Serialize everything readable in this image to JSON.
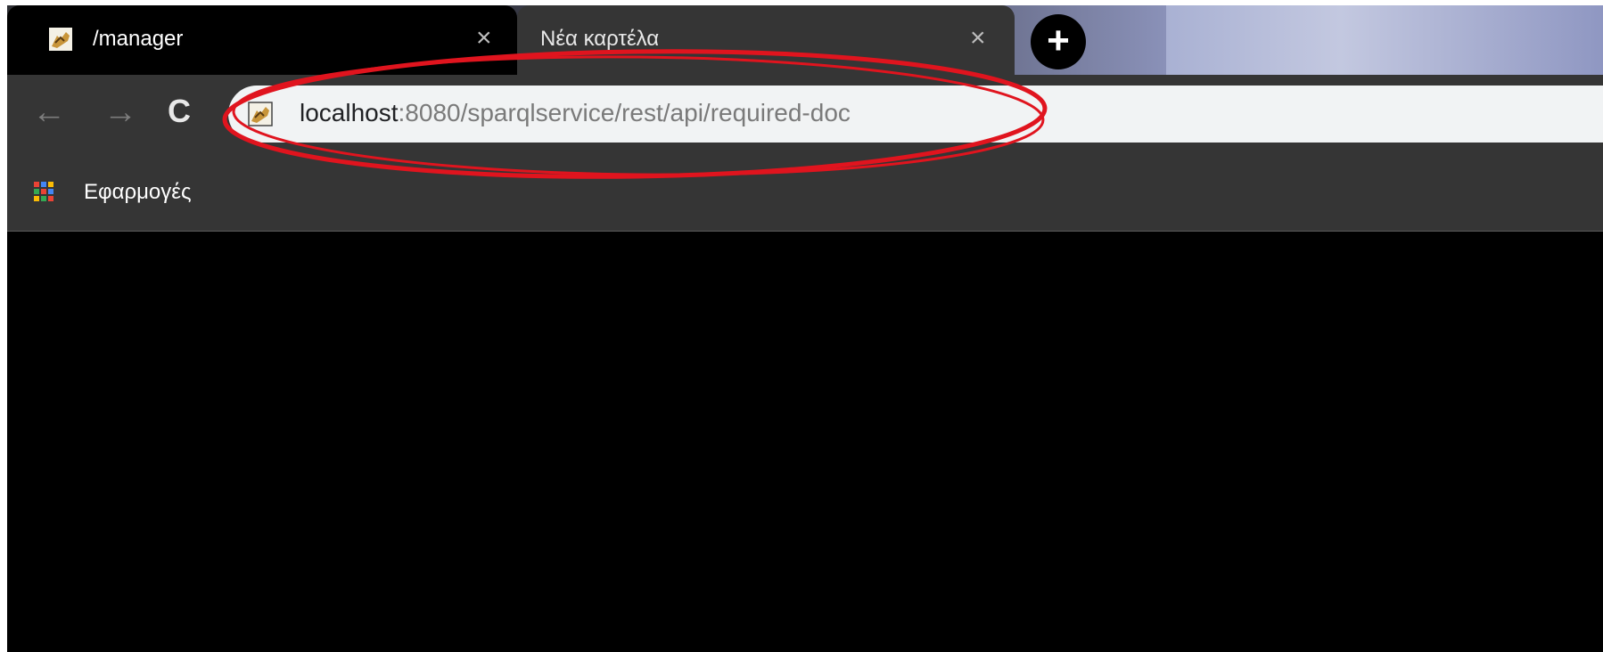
{
  "tabs": [
    {
      "title": "/manager",
      "close": "×",
      "favicon": "tomcat-icon",
      "active": true
    },
    {
      "title": "Νέα καρτέλα",
      "close": "×",
      "active": false
    }
  ],
  "new_tab_glyph": "+",
  "toolbar": {
    "back_glyph": "←",
    "forward_glyph": "→",
    "reload_glyph": "C"
  },
  "omnibox": {
    "favicon": "tomcat-icon",
    "url_host": "localhost",
    "url_rest": ":8080/sparqlservice/rest/api/required-doc"
  },
  "bookmarks": {
    "apps_label": "Εφαρμογές",
    "apps_icon": "apps-grid-icon",
    "apps_colors": [
      "#ea4335",
      "#4285f4",
      "#fbbc05",
      "#34a853",
      "#ea4335",
      "#4285f4",
      "#fbbc05",
      "#34a853",
      "#ea4335"
    ]
  },
  "annotation": {
    "shape": "ellipse",
    "color": "#e0141e"
  },
  "colors": {
    "chrome_dark": "#353535",
    "active_tab": "#000000",
    "content": "#000000"
  }
}
